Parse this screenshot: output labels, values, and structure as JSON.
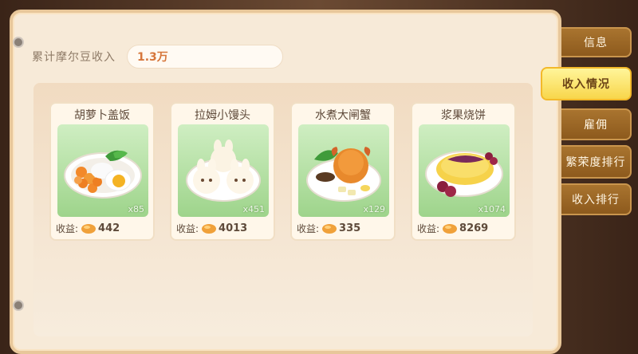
{
  "income": {
    "label": "累计摩尔豆收入",
    "value": "1.3万"
  },
  "tabs": [
    {
      "label": "信息",
      "active": false
    },
    {
      "label": "收入情况",
      "active": true
    },
    {
      "label": "雇佣",
      "active": false
    },
    {
      "label": "繁荣度排行",
      "active": false
    },
    {
      "label": "收入排行",
      "active": false
    }
  ],
  "dishes": [
    {
      "name": "胡萝卜盖饭",
      "count": "x85",
      "earn_label": "收益:",
      "earn_value": "442",
      "icon": "carrot-rice-icon"
    },
    {
      "name": "拉姆小馒头",
      "count": "x451",
      "earn_label": "收益:",
      "earn_value": "4013",
      "icon": "buns-icon"
    },
    {
      "name": "水煮大闸蟹",
      "count": "x129",
      "earn_label": "收益:",
      "earn_value": "335",
      "icon": "crab-icon"
    },
    {
      "name": "浆果烧饼",
      "count": "x1074",
      "earn_label": "收益:",
      "earn_value": "8269",
      "icon": "berry-pancake-icon"
    }
  ],
  "colors": {
    "panel": "#f7ead8",
    "tab_active": "#f8d64b",
    "tab_inactive": "#8d5a1d",
    "income_value": "#d6763b"
  }
}
